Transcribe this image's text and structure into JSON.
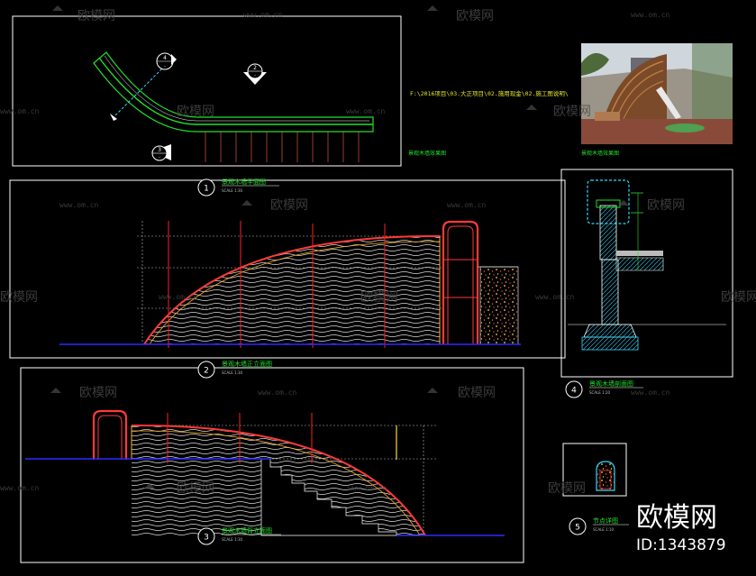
{
  "watermarks": {
    "brand": "欧模网",
    "url": "www.om.cn"
  },
  "file_path": "F:\\2016项目\\03.大正项目\\02.施用现金\\02.施工图说明\\",
  "labels": {
    "plan_note": "景观木墙效果图",
    "photo_note": "景观木墙效果图"
  },
  "drawings": [
    {
      "number": "1",
      "title": "景观木墙平面图",
      "scale": "SCALE      1:30"
    },
    {
      "number": "2",
      "title": "景观木墙正立面图",
      "scale": "SCALE      1:30"
    },
    {
      "number": "3",
      "title": "景观木墙背立面图",
      "scale": "SCALE      1:30"
    },
    {
      "number": "4",
      "title": "景观木墙剖面图",
      "scale": "SCALE      1:20"
    },
    {
      "number": "5",
      "title": "节点详图",
      "scale": "SCALE      1:10"
    }
  ],
  "callouts": [
    {
      "top": "4",
      "bottom": "-"
    },
    {
      "top": "2",
      "bottom": "-"
    },
    {
      "top": "3",
      "bottom": "-"
    }
  ],
  "footer": {
    "brand": "欧模网",
    "id_label": "ID:1343879"
  },
  "colors": {
    "background": "#000000",
    "frame": "#ffffff",
    "arc": "#ff3a3a",
    "ground": "#2a2aff",
    "title": "#22e02a",
    "cyan": "#30d8ff"
  }
}
